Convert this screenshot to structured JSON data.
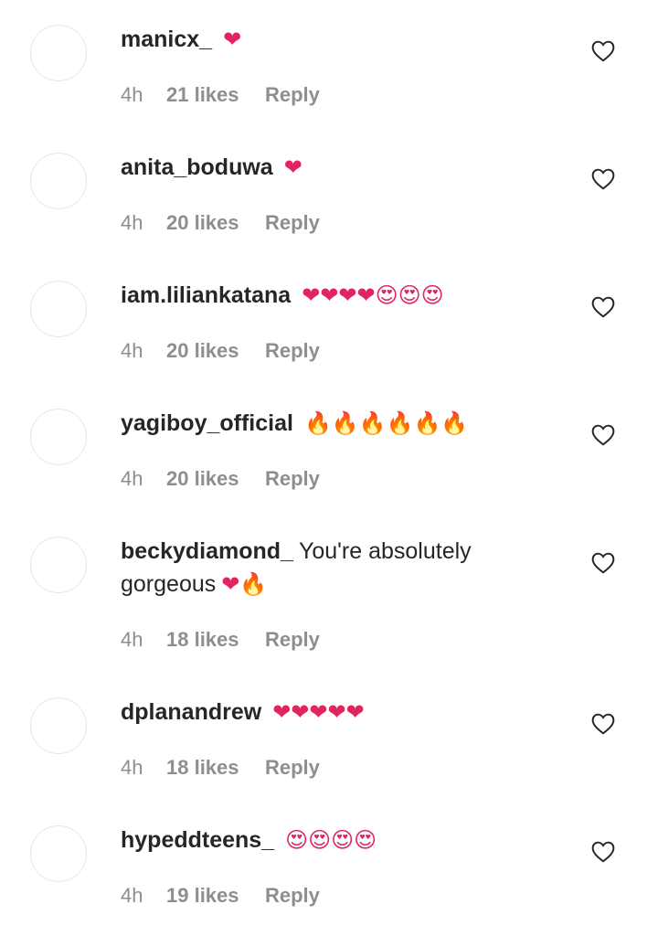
{
  "comments": [
    {
      "username": "manicx_",
      "text": "",
      "emoji": "❤",
      "time": "4h",
      "likes": "21 likes",
      "reply": "Reply"
    },
    {
      "username": "anita_boduwa",
      "text": "",
      "emoji": "❤",
      "time": "4h",
      "likes": "20 likes",
      "reply": "Reply"
    },
    {
      "username": "iam.liliankatana",
      "text": "",
      "emoji": "❤❤❤❤😍😍😍",
      "time": "4h",
      "likes": "20 likes",
      "reply": "Reply"
    },
    {
      "username": "yagiboy_official",
      "text": "",
      "emoji": "🔥🔥🔥🔥🔥🔥",
      "time": "4h",
      "likes": "20 likes",
      "reply": "Reply"
    },
    {
      "username": "beckydiamond_",
      "text": "You're absolutely gorgeous",
      "emoji": "❤🔥",
      "time": "4h",
      "likes": "18 likes",
      "reply": "Reply"
    },
    {
      "username": "dplanandrew",
      "text": "",
      "emoji": "❤❤❤❤❤",
      "time": "4h",
      "likes": "18 likes",
      "reply": "Reply"
    },
    {
      "username": "hypeddteens_",
      "text": "",
      "emoji": "😍😍😍😍",
      "time": "4h",
      "likes": "19 likes",
      "reply": "Reply"
    }
  ],
  "icons": {
    "avatar": "avatar-placeholder",
    "like": "heart-outline-icon"
  },
  "colors": {
    "text": "#262626",
    "meta": "#8e8e8e",
    "heart_emoji": "#e0245e"
  }
}
